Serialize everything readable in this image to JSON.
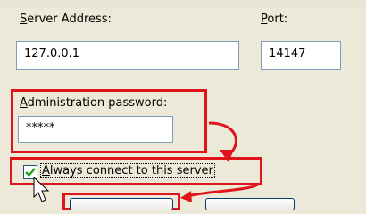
{
  "server": {
    "address_label_lead": "S",
    "address_label_rest": "erver Address:",
    "address_value": "127.0.0.1",
    "port_label_lead": "P",
    "port_label_rest": "ort:",
    "port_value": "14147"
  },
  "admin": {
    "password_label_lead": "A",
    "password_label_rest": "dministration password:",
    "password_value": "*****"
  },
  "always_connect": {
    "label_lead": "A",
    "label_rest": "lways connect to this server",
    "checked": true
  },
  "colors": {
    "highlight": "#e0151b",
    "dialog_bg": "#ece9d8",
    "field_border": "#7f9db9"
  },
  "icons": [
    "checkmark-icon",
    "mouse-pointer-icon",
    "red-arrow-icon"
  ]
}
